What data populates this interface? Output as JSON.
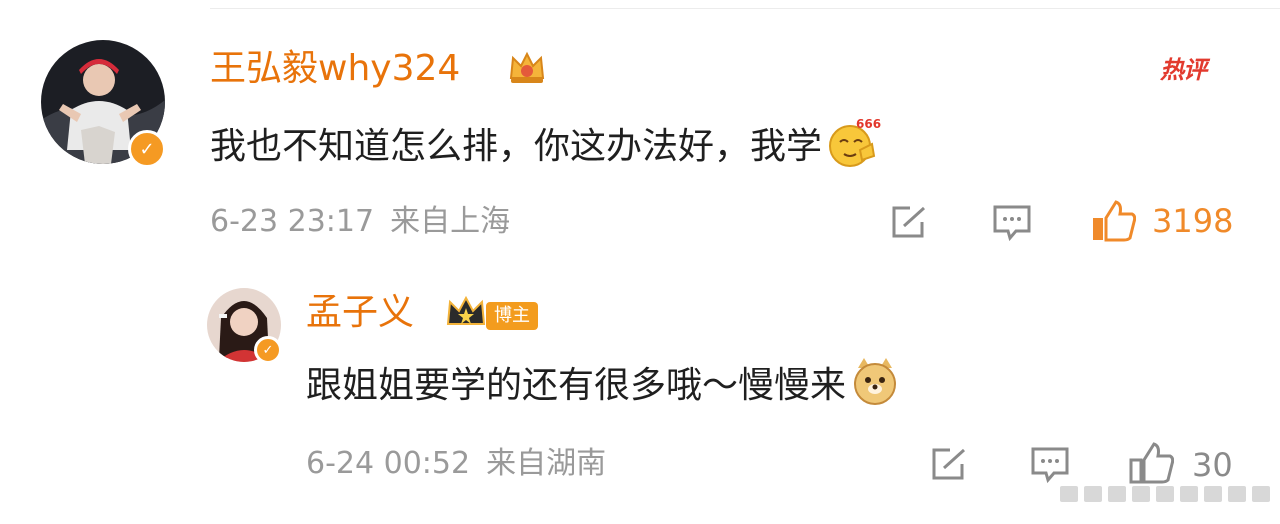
{
  "colors": {
    "username": "#e8730a",
    "hot": "#e23a2e",
    "like_active": "#f08a2a",
    "meta": "#9a9a9a",
    "badge": "#f39c1e"
  },
  "comments": [
    {
      "username": "王弘毅why324",
      "text": "我也不知道怎么排，你这办法好，我学",
      "emoji": "666-emoji",
      "date": "6-23 23:17",
      "location": "来自上海",
      "likes": "3198",
      "hot_label": "热评",
      "badge_icon": "crown-icon"
    },
    {
      "username": "孟子义",
      "badge_label": "博主",
      "text": "跟姐姐要学的还有很多哦～慢慢来",
      "emoji": "doge-emoji",
      "date": "6-24 00:52",
      "location": "来自湖南",
      "likes": "30",
      "badge_icon": "crown-icon"
    }
  ]
}
